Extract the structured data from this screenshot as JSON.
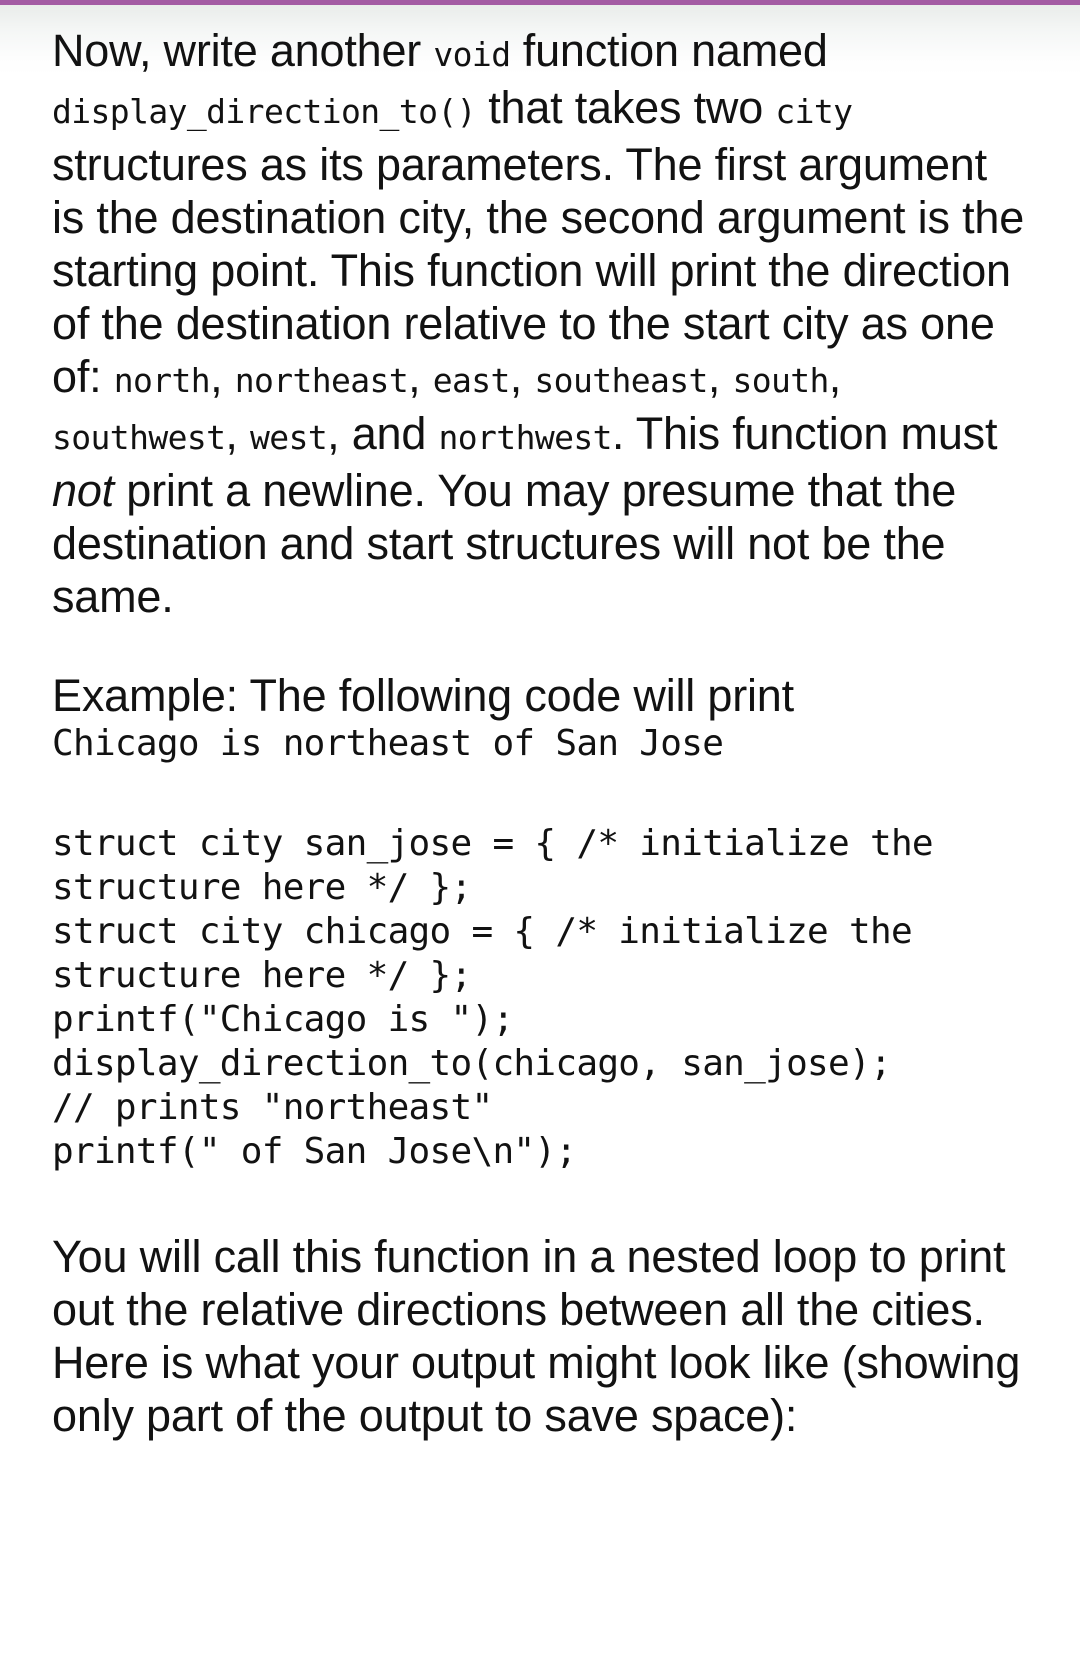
{
  "theme": {
    "accent_color": "#a35ba3",
    "page_background": "#ffffff",
    "text_color": "#121212"
  },
  "content": {
    "paragraph_1": {
      "seg_1": "Now, write another ",
      "code_1": "void",
      "seg_2": " function named ",
      "code_2": "display_direction_to()",
      "seg_3": " that takes two ",
      "code_3": "city",
      "seg_4": " structures as its parameters. The first argument is the destination city, the second argument is the starting point. This function will print the direction of the destination relative to the start city as one of: ",
      "dir_1": "north",
      "sep_1": ", ",
      "dir_2": "northeast",
      "sep_2": ", ",
      "dir_3": "east",
      "sep_3": ", ",
      "dir_4": "southeast",
      "sep_4": ", ",
      "dir_5": "south",
      "sep_5": ", ",
      "dir_6": "southwest",
      "sep_6": ", ",
      "dir_7": "west",
      "sep_7": ", and ",
      "dir_8": "northwest",
      "seg_5": ". This function must ",
      "emphasis": "not",
      "seg_6": " print a newline. You may presume that the destination and start structures will not be the same."
    },
    "example_intro": "Example: The following code will print",
    "example_output": "Chicago is northeast of San Jose",
    "code_block": "struct city san_jose = { /* initialize the structure here */ };\nstruct city chicago = { /* initialize the structure here */ };\nprintf(\"Chicago is \");\ndisplay_direction_to(chicago, san_jose);\n// prints \"northeast\"\nprintf(\" of San Jose\\n\");",
    "paragraph_2": "You will call this function in a nested loop to print out the relative directions between all the cities. Here is what your output might look like (showing only part of the output to save space):"
  }
}
